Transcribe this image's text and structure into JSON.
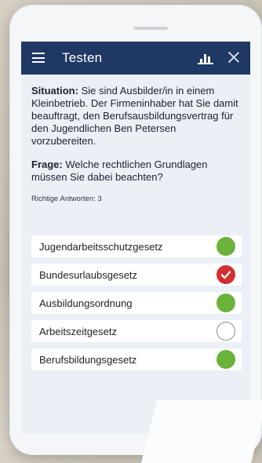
{
  "app": {
    "title": "Testen",
    "icons": {
      "menu": "hamburger-menu-icon",
      "stats": "bar-chart-icon",
      "close": "close-icon"
    }
  },
  "question": {
    "situation_label": "Situation:",
    "situation_text": "Sie sind Ausbilder/in in einem Kleinbetrieb. Der Firmeninhaber hat Sie damit beauftragt, den Berufsausbildungsvertrag für den Jugendlichen Ben Petersen vorzubereiten.",
    "frage_label": "Frage:",
    "frage_text": "Welche rechtlichen Grundlagen müssen Sie dabei beachten?",
    "correct_count_label": "Richtige Antworten: 3"
  },
  "answers": [
    {
      "label": "Jugendarbeitsschutzgesetz",
      "status": "correct"
    },
    {
      "label": "Bundesurlaubsgesetz",
      "status": "selected-check"
    },
    {
      "label": "Ausbildungsordnung",
      "status": "correct"
    },
    {
      "label": "Arbeitszeitgesetz",
      "status": "empty"
    },
    {
      "label": "Berufsbildungsgesetz",
      "status": "correct"
    }
  ],
  "colors": {
    "appbar": "#1f3864",
    "correct_green": "#6ab23a",
    "check_red": "#d32f2f",
    "screen_bg": "#eaf0f6"
  }
}
